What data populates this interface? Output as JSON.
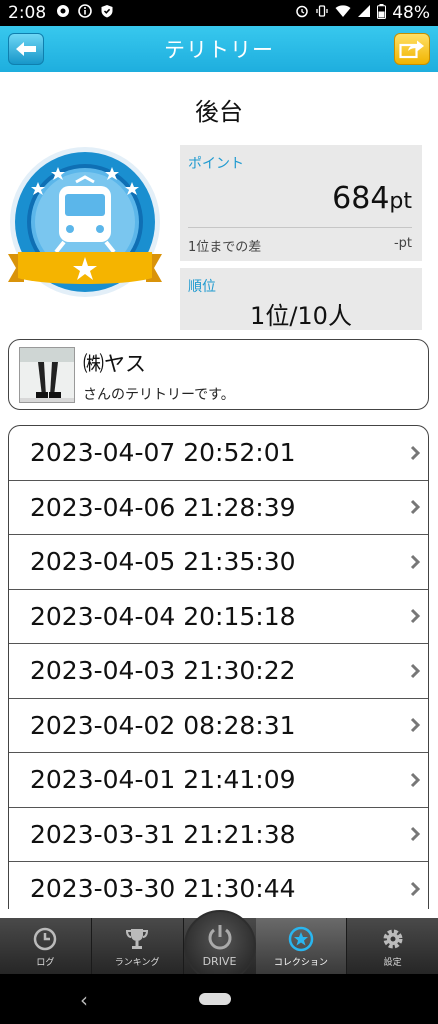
{
  "status_bar": {
    "time": "2:08",
    "battery": "48%",
    "icons_left": [
      "notification-icon",
      "info-icon",
      "shield-icon"
    ],
    "icons_right": [
      "alarm-icon",
      "vibrate-icon",
      "wifi-icon",
      "signal-icon",
      "battery-icon"
    ]
  },
  "header": {
    "title": "テリトリー",
    "back_icon": "back-arrow-icon",
    "share_icon": "share-icon"
  },
  "territory": {
    "name": "後台",
    "badge_icon": "train-badge-icon"
  },
  "points": {
    "label": "ポイント",
    "value": "684",
    "unit": "pt",
    "diff_label": "1位までの差",
    "diff_value": "-pt"
  },
  "rank": {
    "label": "順位",
    "value": "1位/10人"
  },
  "owner": {
    "name": "㈱ヤス",
    "subtitle": "さんのテリトリーです。"
  },
  "history": [
    "2023-04-07 20:52:01",
    "2023-04-06 21:28:39",
    "2023-04-05 21:35:30",
    "2023-04-04 20:15:18",
    "2023-04-03 21:30:22",
    "2023-04-02 08:28:31",
    "2023-04-01 21:41:09",
    "2023-03-31 21:21:38",
    "2023-03-30 21:30:44"
  ],
  "tabs": {
    "log": "ログ",
    "ranking": "ランキング",
    "drive": "DRIVE",
    "collection": "コレクション",
    "settings": "設定",
    "active": "collection"
  },
  "colors": {
    "header": "#1eaede",
    "accent": "#1f9ad0",
    "badge_blue": "#1a8fd0",
    "ribbon": "#f5b400"
  }
}
